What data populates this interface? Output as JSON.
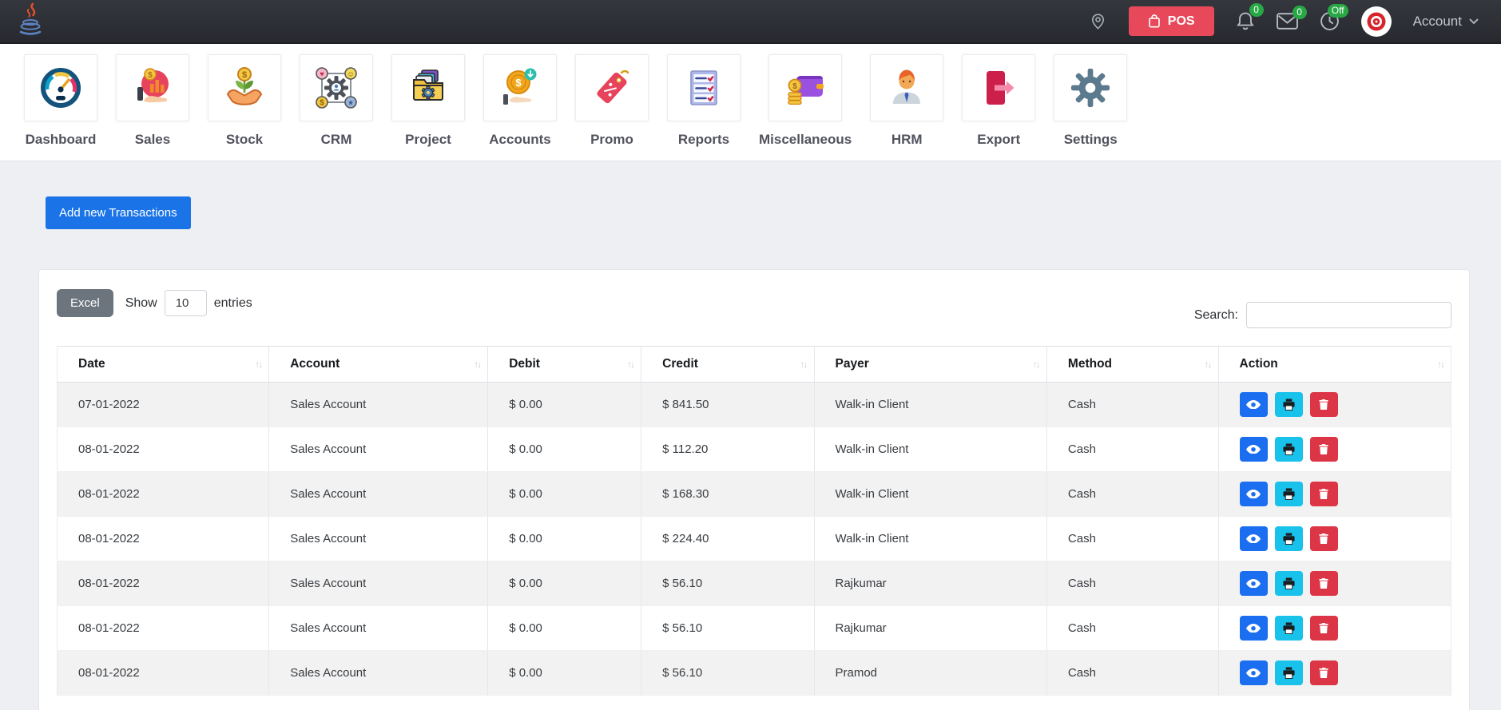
{
  "navbar": {
    "pos_label": "POS",
    "account_label": "Account",
    "notifications_badge": "0",
    "messages_badge": "0",
    "clock_badge": "Off"
  },
  "menu": {
    "items": [
      {
        "label": "Dashboard",
        "icon": "dashboard-gauge-icon"
      },
      {
        "label": "Sales",
        "icon": "sales-hand-chart-icon"
      },
      {
        "label": "Stock",
        "icon": "stock-plant-coin-icon"
      },
      {
        "label": "CRM",
        "icon": "crm-network-icon"
      },
      {
        "label": "Project",
        "icon": "project-folder-gear-icon"
      },
      {
        "label": "Accounts",
        "icon": "accounts-coin-hand-icon"
      },
      {
        "label": "Promo",
        "icon": "promo-tag-icon"
      },
      {
        "label": "Reports",
        "icon": "reports-checklist-icon"
      },
      {
        "label": "Miscellaneous",
        "icon": "miscellaneous-wallet-icon"
      },
      {
        "label": "HRM",
        "icon": "hrm-person-icon"
      },
      {
        "label": "Export",
        "icon": "export-arrow-icon"
      },
      {
        "label": "Settings",
        "icon": "settings-gear-icon"
      }
    ]
  },
  "content": {
    "add_button_label": "Add new Transactions",
    "toolbar": {
      "excel_label": "Excel",
      "show_label": "Show",
      "entries_value": "10",
      "entries_label": "entries",
      "search_label": "Search:",
      "search_value": ""
    },
    "table": {
      "sort_glyph": "↑↓",
      "columns": [
        "Date",
        "Account",
        "Debit",
        "Credit",
        "Payer",
        "Method",
        "Action"
      ],
      "rows": [
        {
          "date": "07-01-2022",
          "account": "Sales Account",
          "debit": "$ 0.00",
          "credit": "$ 841.50",
          "payer": "Walk-in Client",
          "method": "Cash"
        },
        {
          "date": "08-01-2022",
          "account": "Sales Account",
          "debit": "$ 0.00",
          "credit": "$ 112.20",
          "payer": "Walk-in Client",
          "method": "Cash"
        },
        {
          "date": "08-01-2022",
          "account": "Sales Account",
          "debit": "$ 0.00",
          "credit": "$ 168.30",
          "payer": "Walk-in Client",
          "method": "Cash"
        },
        {
          "date": "08-01-2022",
          "account": "Sales Account",
          "debit": "$ 0.00",
          "credit": "$ 224.40",
          "payer": "Walk-in Client",
          "method": "Cash"
        },
        {
          "date": "08-01-2022",
          "account": "Sales Account",
          "debit": "$ 0.00",
          "credit": "$ 56.10",
          "payer": "Rajkumar",
          "method": "Cash"
        },
        {
          "date": "08-01-2022",
          "account": "Sales Account",
          "debit": "$ 0.00",
          "credit": "$ 56.10",
          "payer": "Rajkumar",
          "method": "Cash"
        },
        {
          "date": "08-01-2022",
          "account": "Sales Account",
          "debit": "$ 0.00",
          "credit": "$ 56.10",
          "payer": "Pramod",
          "method": "Cash"
        }
      ],
      "action_buttons": [
        "view",
        "print",
        "delete"
      ]
    }
  },
  "colors": {
    "navbar_bg": "#2b2e34",
    "pos_red": "#e8495a",
    "badge_green": "#28a745",
    "primary_blue": "#1a74e8",
    "excel_gray": "#6c757d",
    "view_blue": "#1b6ef0",
    "print_cyan": "#18c2ea",
    "delete_red": "#dc3545",
    "row_stripe": "#f2f2f2"
  }
}
